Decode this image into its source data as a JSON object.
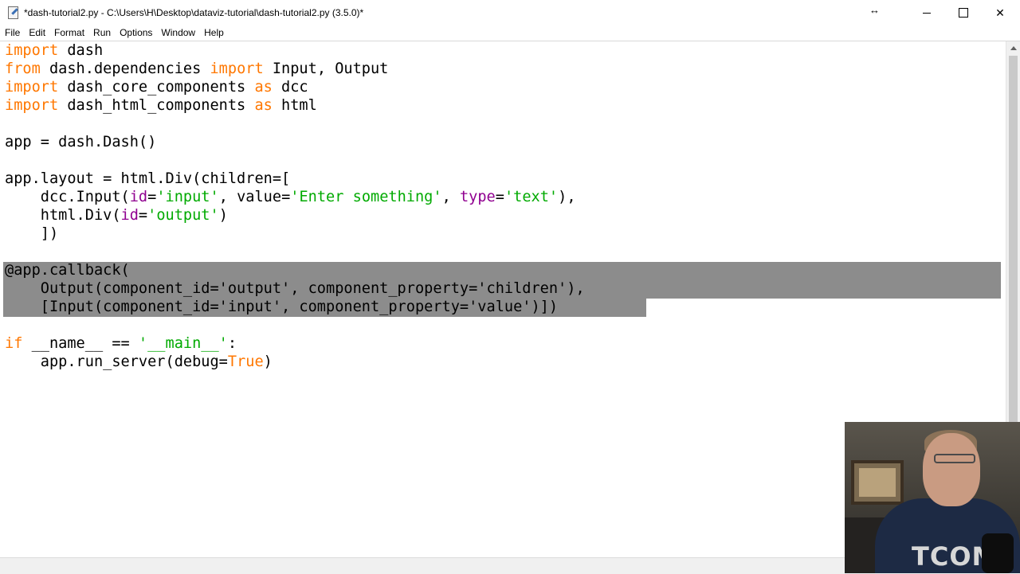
{
  "window": {
    "title": "*dash-tutorial2.py - C:\\Users\\H\\Desktop\\dataviz-tutorial\\dash-tutorial2.py (3.5.0)*",
    "resize_glyph": "↔",
    "close_glyph": "✕"
  },
  "menu": [
    "File",
    "Edit",
    "Format",
    "Run",
    "Options",
    "Window",
    "Help"
  ],
  "code": {
    "l1": [
      {
        "t": "import",
        "c": "kw"
      },
      {
        "t": " dash",
        "c": ""
      }
    ],
    "l2": [
      {
        "t": "from",
        "c": "kw"
      },
      {
        "t": " dash.dependencies ",
        "c": ""
      },
      {
        "t": "import",
        "c": "kw"
      },
      {
        "t": " Input, Output",
        "c": ""
      }
    ],
    "l3": [
      {
        "t": "import",
        "c": "kw"
      },
      {
        "t": " dash_core_components ",
        "c": ""
      },
      {
        "t": "as",
        "c": "kw"
      },
      {
        "t": " dcc",
        "c": ""
      }
    ],
    "l4": [
      {
        "t": "import",
        "c": "kw"
      },
      {
        "t": " dash_html_components ",
        "c": ""
      },
      {
        "t": "as",
        "c": "kw"
      },
      {
        "t": " html",
        "c": ""
      }
    ],
    "l6": [
      {
        "t": "app = dash.Dash()",
        "c": ""
      }
    ],
    "l8": [
      {
        "t": "app.layout = html.Div(children=[",
        "c": ""
      }
    ],
    "l9": [
      {
        "t": "    dcc.Input(",
        "c": ""
      },
      {
        "t": "id",
        "c": "kwarg"
      },
      {
        "t": "=",
        "c": ""
      },
      {
        "t": "'input'",
        "c": "str"
      },
      {
        "t": ", value=",
        "c": ""
      },
      {
        "t": "'Enter something'",
        "c": "str"
      },
      {
        "t": ", ",
        "c": ""
      },
      {
        "t": "type",
        "c": "kwarg"
      },
      {
        "t": "=",
        "c": ""
      },
      {
        "t": "'text'",
        "c": "str"
      },
      {
        "t": "),",
        "c": ""
      }
    ],
    "l10": [
      {
        "t": "    html.Div(",
        "c": ""
      },
      {
        "t": "id",
        "c": "kwarg"
      },
      {
        "t": "=",
        "c": ""
      },
      {
        "t": "'output'",
        "c": "str"
      },
      {
        "t": ")",
        "c": ""
      }
    ],
    "l11": [
      {
        "t": "    ])",
        "c": ""
      }
    ],
    "l13": [
      {
        "t": "@app.callback(",
        "c": ""
      }
    ],
    "l14": [
      {
        "t": "    Output(component_id='output', component_property='children'),",
        "c": ""
      }
    ],
    "l15": [
      {
        "t": "    [Input(component_id='input', component_property='value')])",
        "c": ""
      }
    ],
    "l17": [
      {
        "t": "if",
        "c": "kw"
      },
      {
        "t": " __name__ == ",
        "c": ""
      },
      {
        "t": "'__main__'",
        "c": "str"
      },
      {
        "t": ":",
        "c": ""
      }
    ],
    "l18": [
      {
        "t": "    app.run_server(debug=",
        "c": ""
      },
      {
        "t": "True",
        "c": "kw"
      },
      {
        "t": ")",
        "c": ""
      }
    ]
  },
  "webcam": {
    "shirt_text": "TCOM"
  },
  "colors": {
    "keyword": "#ff7700",
    "string": "#00aa00",
    "builtin_kwarg": "#900090",
    "selection": "#8c8c8c"
  }
}
